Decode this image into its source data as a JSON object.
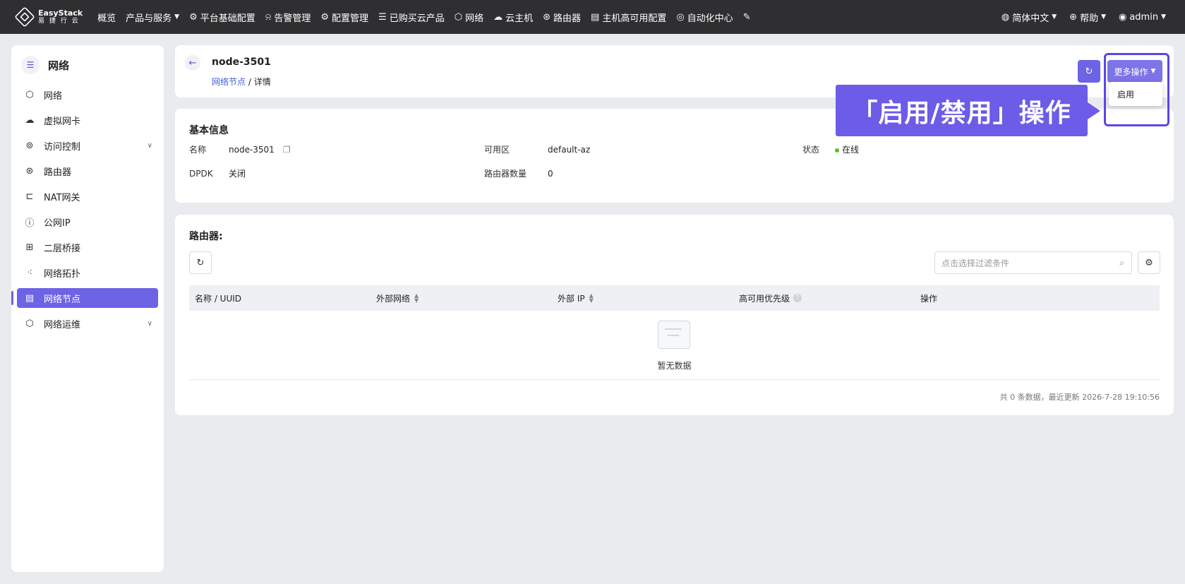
{
  "topbar": {
    "brand": "EasyStack",
    "brand_sub": "易 捷 行 云",
    "nav": [
      {
        "label": "概览",
        "icon": ""
      },
      {
        "label": "产品与服务",
        "icon": ""
      },
      {
        "label": "平台基础配置",
        "icon": "gear-icon"
      },
      {
        "label": "告警管理",
        "icon": "alarm-icon"
      },
      {
        "label": "配置管理",
        "icon": "gear-icon"
      },
      {
        "label": "已购买云产品",
        "icon": "list-icon"
      },
      {
        "label": "网络",
        "icon": "network-icon"
      },
      {
        "label": "云主机",
        "icon": "cloud-icon"
      },
      {
        "label": "路由器",
        "icon": "router-icon"
      },
      {
        "label": "主机高可用配置",
        "icon": "host-icon"
      },
      {
        "label": "自动化中心",
        "icon": "automation-icon"
      }
    ],
    "language": "简体中文",
    "help": "帮助",
    "user": "admin"
  },
  "sidebar": {
    "title": "网络",
    "items": [
      {
        "label": "网络",
        "icon": "network-icon"
      },
      {
        "label": "虚拟网卡",
        "icon": "nic-icon"
      },
      {
        "label": "访问控制",
        "icon": "access-control-icon"
      },
      {
        "label": "路由器",
        "icon": "router-icon"
      },
      {
        "label": "NAT网关",
        "icon": "nat-gateway-icon"
      },
      {
        "label": "公网IP",
        "icon": "public-ip-icon"
      },
      {
        "label": "二层桥接",
        "icon": "bridge-icon"
      },
      {
        "label": "网络拓扑",
        "icon": "topology-icon"
      },
      {
        "label": "网络节点",
        "icon": "node-icon"
      },
      {
        "label": "网络运维",
        "icon": "ops-icon"
      }
    ],
    "active_index": 8
  },
  "header": {
    "title": "node-3501",
    "breadcrumb_link": "网络节点",
    "breadcrumb_sep": "/",
    "breadcrumb_current": "详情",
    "more_actions": "更多操作"
  },
  "dropdown": {
    "item": "启用"
  },
  "callout": {
    "text": "「启用/禁用」操作"
  },
  "basic_info": {
    "title": "基本信息",
    "name_label": "名称",
    "name_value": "node-3501",
    "az_label": "可用区",
    "az_value": "default-az",
    "status_label": "状态",
    "status_value": "在线",
    "dpdk_label": "DPDK",
    "dpdk_value": "关闭",
    "router_count_label": "路由器数量",
    "router_count_value": "0"
  },
  "routers": {
    "title": "路由器:",
    "search_placeholder": "点击选择过滤条件",
    "columns": [
      "名称 / UUID",
      "外部网络",
      "外部 IP",
      "高可用优先级",
      "操作"
    ],
    "empty_text": "暂无数据",
    "footer": "共 0 条数据，最近更新  2026-7-28 19:10:56"
  },
  "colors": {
    "accent": "#6c63e5",
    "topbar": "#2f2f31",
    "status_online": "#52c41a",
    "callout": "#6c5ce7"
  }
}
